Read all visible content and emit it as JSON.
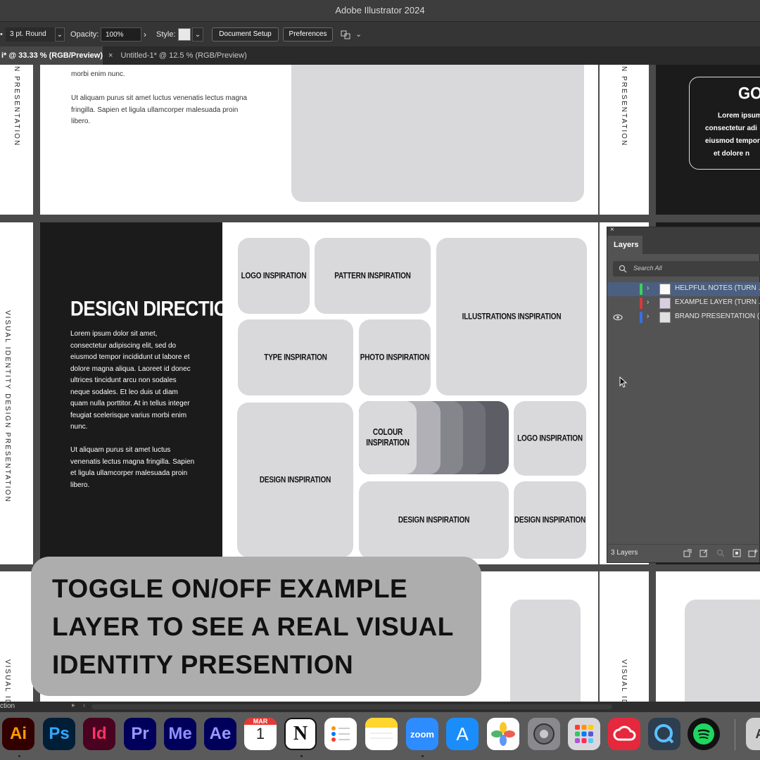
{
  "window": {
    "title": "Adobe Illustrator 2024"
  },
  "control_bar": {
    "stroke_bullet": "•",
    "stroke_value": "3 pt. Round",
    "opacity_label": "Opacity:",
    "opacity_value": "100%",
    "style_label": "Style:",
    "document_setup_label": "Document Setup",
    "preferences_label": "Preferences"
  },
  "tabs": [
    {
      "label": "i* @ 33.33 % (RGB/Preview)",
      "active": true
    },
    {
      "label": "Untitled-1* @ 12.5 % (RGB/Preview)",
      "close": "×",
      "active": false
    }
  ],
  "canvas": {
    "top_artboard": {
      "text_line1": "morbi enim nunc.",
      "para2": [
        "Ut aliquam purus sit amet luctus venenatis lectus magna",
        "fringilla. Sapien et ligula ullamcorper malesuada proin",
        "libero."
      ],
      "vertical_label": "N PRESENTATION"
    },
    "goal_card": {
      "title": "GOA",
      "lines": [
        "Lorem ipsum",
        "consectetur adi",
        "eiusmod tempor",
        "et dolore n"
      ]
    },
    "main_artboard": {
      "vertical_label": "VISUAL IDENTITY DESIGN PRESENTATION",
      "heading": "DESIGN DIRECTION",
      "para1": [
        "Lorem ipsum dolor sit amet,",
        "consectetur adipiscing elit, sed do",
        "eiusmod tempor incididunt ut labore et",
        "dolore magna aliqua. Laoreet id donec",
        "ultrices tincidunt arcu non sodales",
        "neque sodales. Et leo duis ut diam",
        "quam nulla porttitor. At in tellus integer",
        "feugiat scelerisque varius morbi enim",
        "nunc."
      ],
      "para2": [
        "Ut aliquam purus sit amet luctus",
        "venenatis lectus magna fringilla. Sapien",
        "et ligula ullamcorper malesuada proin",
        "libero."
      ],
      "tiles": {
        "logo1": "LOGO INSPIRATION",
        "pattern": "PATTERN INSPIRATION",
        "illustrations": "ILLUSTRATIONS INSPIRATION",
        "type": "TYPE INSPIRATION",
        "photo": "PHOTO INSPIRATION",
        "design_tall": "DESIGN INSPIRATION",
        "colour": [
          "COLOUR",
          "INSPIRATION"
        ],
        "logo2": "LOGO INSPIRATION",
        "design_wide": "DESIGN INSPIRATION",
        "design_small": "DESIGN INSPIRATION"
      },
      "colour_swatches": [
        "#b0b0b6",
        "#9a9aa0",
        "#85858c",
        "#6f6f77",
        "#5d5d66"
      ]
    },
    "bottom_vertical_label": "VISUAL ID"
  },
  "layers_panel": {
    "title": "Layers",
    "search_placeholder": "Search All",
    "layers": [
      {
        "name": "HELPFUL NOTES (TURN ...",
        "color": "#3fcf5a",
        "visible": false,
        "selected": true
      },
      {
        "name": "EXAMPLE LAYER (TURN ...",
        "color": "#d63a3a",
        "visible": false,
        "selected": false
      },
      {
        "name": "BRAND PRESENTATION (...",
        "color": "#3a6fe0",
        "visible": true,
        "selected": false
      }
    ],
    "footer_count": "3 Layers"
  },
  "overlay": {
    "lines": [
      "TOGGLE ON/OFF EXAMPLE",
      "LAYER TO SEE A REAL VISUAL",
      "IDENTITY PRESENTION"
    ]
  },
  "status_bar": {
    "left_text": "ction"
  },
  "dock": {
    "apps": [
      {
        "label": "Ai",
        "name": "illustrator-icon",
        "bg": "#330000",
        "fg": "#ff9a00"
      },
      {
        "label": "Ps",
        "name": "photoshop-icon",
        "bg": "#001e36",
        "fg": "#31a8ff"
      },
      {
        "label": "Id",
        "name": "indesign-icon",
        "bg": "#49021f",
        "fg": "#ff3366"
      },
      {
        "label": "Pr",
        "name": "premiere-icon",
        "bg": "#00005b",
        "fg": "#9999ff"
      },
      {
        "label": "Me",
        "name": "media-encoder-icon",
        "bg": "#00005b",
        "fg": "#8f8fff"
      },
      {
        "label": "Ae",
        "name": "after-effects-icon",
        "bg": "#00005b",
        "fg": "#9999ff"
      },
      {
        "label": "1",
        "month": "MAR",
        "name": "calendar-icon",
        "bg": "#ffffff",
        "fg": "#222222"
      },
      {
        "label": "N",
        "name": "notion-icon",
        "bg": "#ffffff",
        "fg": "#111111"
      },
      {
        "label": "",
        "name": "reminders-icon",
        "bg": "#ffffff",
        "fg": "#111111"
      },
      {
        "label": "",
        "name": "notes-icon",
        "bg": "#ffffff",
        "fg": "#111111"
      },
      {
        "label": "zoom",
        "name": "zoom-icon",
        "bg": "#2d8cff",
        "fg": "#ffffff"
      },
      {
        "label": "A",
        "name": "app-store-icon",
        "bg": "#1b8dfb",
        "fg": "#ffffff"
      },
      {
        "label": "",
        "name": "photos-icon",
        "bg": "#ffffff",
        "fg": "#111111"
      },
      {
        "label": "",
        "name": "system-settings-icon",
        "bg": "#8a8a8e",
        "fg": "#333333"
      },
      {
        "label": "",
        "name": "launchpad-icon",
        "bg": "#d8d8dc",
        "fg": "#111111"
      },
      {
        "label": "",
        "name": "creative-cloud-icon",
        "bg": "#e6283c",
        "fg": "#ffffff"
      },
      {
        "label": "",
        "name": "quicktime-icon",
        "bg": "#2c3e50",
        "fg": "#5bc0ff"
      },
      {
        "label": "",
        "name": "spotify-icon",
        "bg": "#111111",
        "fg": "#1ed760"
      },
      {
        "label": "A",
        "name": "font-book-icon",
        "bg": "#d0d0d0",
        "fg": "#333333"
      }
    ]
  }
}
